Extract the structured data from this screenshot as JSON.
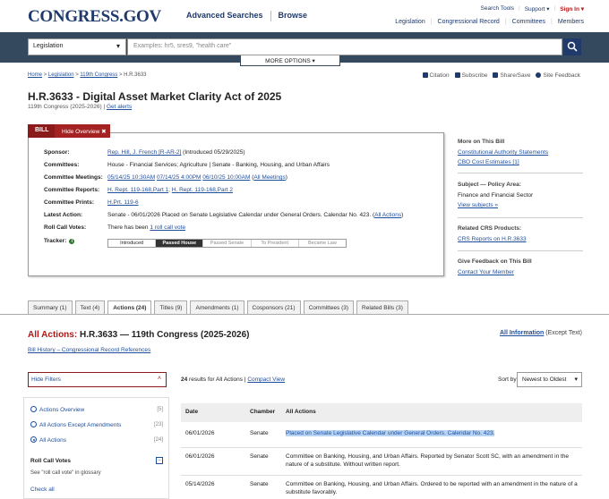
{
  "header": {
    "logo": "CONGRESS.GOV",
    "nav_main": [
      "Advanced Searches",
      "Browse"
    ],
    "nav_util": {
      "search_tools": "Search Tools",
      "support": "Support ▾",
      "sign_in": "Sign In ▾"
    },
    "nav_sec": [
      "Legislation",
      "Congressional Record",
      "Committees",
      "Members"
    ]
  },
  "search": {
    "scope": "Legislation",
    "placeholder": "Examples: hr5, sres9, \"health care\"",
    "more_options": "MORE OPTIONS"
  },
  "breadcrumb": [
    "Home",
    "Legislation",
    "119th Congress",
    "H.R.3633"
  ],
  "tools": [
    "Citation",
    "Subscribe",
    "Share/Save",
    "Site Feedback"
  ],
  "bill": {
    "title": "H.R.3633 - Digital Asset Market Clarity Act of 2025",
    "congress": "119th Congress (2025-2026)",
    "get_alerts": "Get alerts"
  },
  "overview": {
    "tab_bill": "BILL",
    "tab_hide": "Hide Overview",
    "sponsor_label": "Sponsor:",
    "sponsor_link": "Rep. Hill, J. French [R-AR-2]",
    "sponsor_rest": " (Introduced 05/29/2025)",
    "committees_label": "Committees:",
    "committees": "House - Financial Services; Agriculture | Senate - Banking, Housing, and Urban Affairs",
    "meetings_label": "Committee Meetings:",
    "meetings": [
      "05/14/25 10:30AM",
      "07/14/25 4:00PM",
      "06/10/25 10:00AM"
    ],
    "meetings_all": "All Meetings",
    "reports_label": "Committee Reports:",
    "reports": [
      "H. Rept. 119-168,Part 1",
      "H. Rept. 119-168,Part 2"
    ],
    "prints_label": "Committee Prints:",
    "prints": "H.Prt. 119-6",
    "latest_label": "Latest Action:",
    "latest": "Senate - 06/01/2026 Placed on Senate Legislative Calendar under General Orders. Calendar No. 423.",
    "latest_all": "All Actions",
    "rollcall_label": "Roll Call Votes:",
    "rollcall_pre": "There has been ",
    "rollcall_link": "1 roll call vote",
    "tracker_label": "Tracker:",
    "tracker": [
      "Introduced",
      "Passed House",
      "Passed Senate",
      "To President",
      "Became Law"
    ]
  },
  "sidebar": [
    {
      "heading": "More on This Bill",
      "items": [
        "Constitutional Authority Statements",
        "CBO Cost Estimates [1]"
      ]
    },
    {
      "heading": "Subject — Policy Area:",
      "items": [
        "Finance and Financial Sector",
        "View subjects »"
      ]
    },
    {
      "heading": "Related CRS Products:",
      "items": [
        "CRS Reports on H.R.3633"
      ]
    },
    {
      "heading": "Give Feedback on This Bill",
      "items": [
        "Contact Your Member"
      ]
    }
  ],
  "tabs": [
    "Summary (1)",
    "Text (4)",
    "Actions (24)",
    "Titles (9)",
    "Amendments (1)",
    "Cosponsors (21)",
    "Committees (3)",
    "Related Bills (3)"
  ],
  "actions": {
    "heading_red": "All Actions:",
    "heading": " H.R.3633 — 119th Congress (2025-2026)",
    "all_info_link": "All Information",
    "all_info_rest": " (Except Text)",
    "bill_history": "Bill History – Congressional Record References"
  },
  "filters": {
    "hide_filters": "Hide Filters",
    "items": [
      {
        "label": "Actions Overview",
        "count": "[5]"
      },
      {
        "label": "All Actions Except Amendments",
        "count": "[23]"
      },
      {
        "label": "All Actions",
        "count": "[24]"
      }
    ],
    "roll_call_heading": "Roll Call Votes",
    "roll_call_note": "See \"roll call vote\" in glossary",
    "check_all": "Check all"
  },
  "results": {
    "count": "24",
    "count_rest": " results for All Actions | ",
    "compact": "Compact View",
    "sort_label": "Sort by",
    "sort_value": "Newest to Oldest",
    "columns": [
      "Date",
      "Chamber",
      "All Actions"
    ],
    "rows": [
      {
        "date": "06/01/2026",
        "chamber": "Senate",
        "action": "Placed on Senate Legislative Calendar under General Orders. Calendar No. 423."
      },
      {
        "date": "06/01/2026",
        "chamber": "Senate",
        "action": "Committee on Banking, Housing, and Urban Affairs. Reported by Senator Scott SC, with an amendment in the nature of a substitute. Without written report."
      },
      {
        "date": "05/14/2026",
        "chamber": "Senate",
        "action": "Committee on Banking, Housing, and Urban Affairs. Ordered to be reported with an amendment in the nature of a substitute favorably."
      }
    ]
  }
}
